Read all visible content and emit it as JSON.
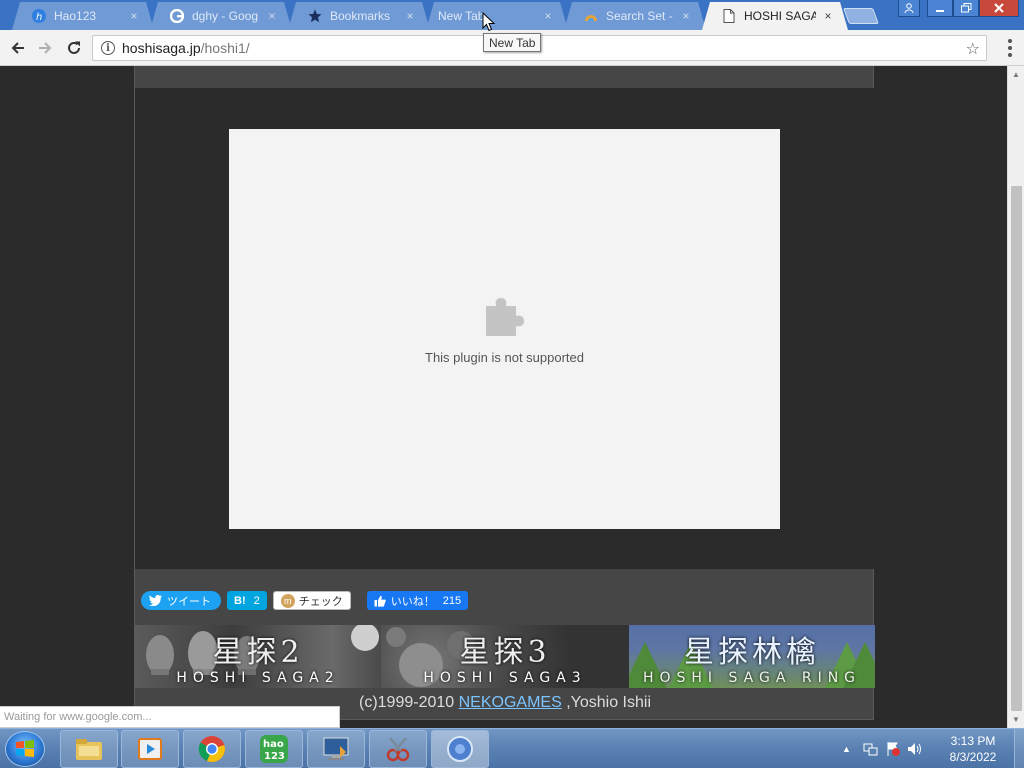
{
  "tabs": [
    {
      "title": "Hao123",
      "icon": "hao123-icon"
    },
    {
      "title": "dghy - Goog",
      "icon": "google-icon"
    },
    {
      "title": "Bookmarks",
      "icon": "star-icon"
    },
    {
      "title": "New Tab",
      "icon": ""
    },
    {
      "title": "Search Set - ",
      "icon": "search-set-icon"
    },
    {
      "title": "HOSHI SAGA",
      "icon": "page-icon",
      "active": true
    }
  ],
  "tab_close_glyph": "×",
  "tooltip": "New Tab",
  "address_bar": {
    "host": "hoshisaga.jp",
    "path": "/hoshi1/"
  },
  "plugin": {
    "message": "This plugin is not supported"
  },
  "share": {
    "tweet_label": "ツイート",
    "hatena_label": "B!",
    "hatena_count": "2",
    "mixi_label": "チェック",
    "like_label": "いいね！",
    "like_count": "215"
  },
  "banners": [
    {
      "title": "星探2",
      "subtitle": "HOSHI SAGA2"
    },
    {
      "title": "星探3",
      "subtitle": "HOSHI SAGA3"
    },
    {
      "title": "星探林檎",
      "subtitle": "HOSHI SAGA RING"
    }
  ],
  "footer": {
    "prefix": "(c)1999-2010 ",
    "link": "NEKOGAMES",
    "suffix": " ,Yoshio Ishii"
  },
  "status_text": "Waiting for www.google.com...",
  "clock": {
    "time": "3:13 PM",
    "date": "8/3/2022"
  },
  "colors": {
    "tabstrip": "#3a72c4",
    "page_bg": "#2b2b2b",
    "content_col": "#464646",
    "tweet": "#1da1f2",
    "hatena": "#00a4de",
    "like": "#1877f2"
  }
}
